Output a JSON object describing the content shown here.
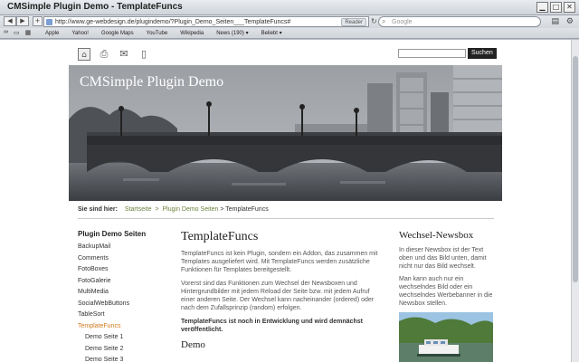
{
  "window": {
    "title": "CMSimple Plugin Demo - TemplateFuncs"
  },
  "toolbar": {
    "url": "http://www.ge-webdesign.de/plugindemo/?Plugin_Demo_Seiten___TemplateFuncs#",
    "reader_label": "Reader",
    "search_placeholder": "Google"
  },
  "bookmarks": {
    "items": [
      "Apple",
      "Yahoo!",
      "Google Maps",
      "YouTube",
      "Wikipedia",
      "News (190) ▾",
      "Beliebt ▾"
    ]
  },
  "page": {
    "search_button": "Suchen",
    "header_title": "CMSimple Plugin Demo",
    "breadcrumb": {
      "label": "Sie sind hier:",
      "home": "Startseite",
      "parent": "Plugin Demo Seiten",
      "current": "TemplateFuncs"
    },
    "sidebar": {
      "title": "Plugin Demo Seiten",
      "items": [
        "BackupMail",
        "Comments",
        "FotoBoxes",
        "FotoGalerie",
        "MultiMedia",
        "SocialWebButtons",
        "TableSort",
        "TemplateFuncs"
      ],
      "sub_items": [
        "Demo Seite 1",
        "Demo Seite 2",
        "Demo Seite 3"
      ]
    },
    "main": {
      "heading": "TemplateFuncs",
      "p1": "TemplateFuncs ist kein Plugin, sondern ein Addon, das zusammen mit Templates ausgeliefert wird. Mit TemplateFuncs werden zusätzliche Funktionen für Templates bereitgestellt.",
      "p2": "Vorerst sind das Funktionen zum Wechsel der Newsboxen und Hintergrundbilder mit jedem Reload der Seite bzw. mit jedem Aufruf einer anderen Seite. Der Wechsel kann nacheinander (ordered) oder nach dem Zufallsprinzip (random) erfolgen.",
      "p3": "TemplateFuncs ist noch in Entwicklung und wird demnächst veröffentlicht.",
      "subheading": "Demo"
    },
    "newsbox": {
      "heading": "Wechsel-Newsbox",
      "p1": "In dieser Newsbox ist der Text oben und das Bild unten, damit nicht nur das Bild wechselt.",
      "p2": "Man kann auch nur ein wechselndes Bild oder ein wechselndes Werbebanner in die Newsbox stellen."
    }
  }
}
